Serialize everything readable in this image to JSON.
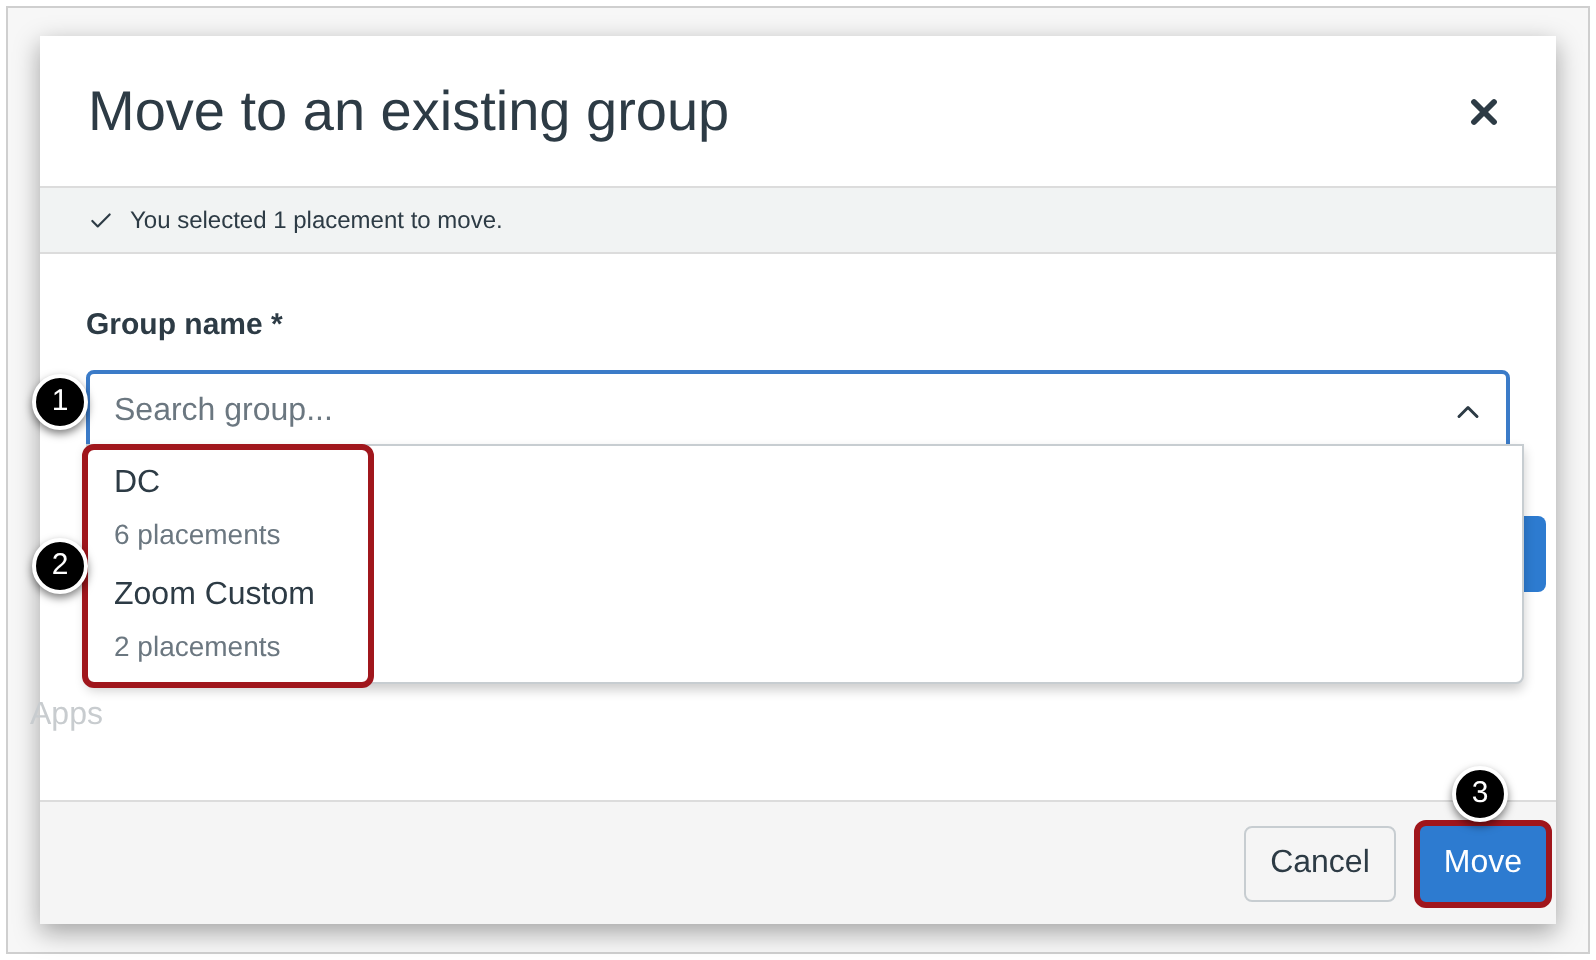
{
  "dialog": {
    "title": "Move to an existing group",
    "notice": "You selected 1 placement to move.",
    "field": {
      "label": "Group name *",
      "placeholder": "Search group...",
      "expanded": true
    },
    "options": [
      {
        "name": "DC",
        "count": "6 placements"
      },
      {
        "name": "Zoom Custom",
        "count": "2 placements"
      }
    ],
    "buttons": [
      {
        "label": "Cancel",
        "kind": "secondary"
      },
      {
        "label": "Move",
        "kind": "primary"
      }
    ]
  },
  "background_text": "Apps",
  "callouts": [
    "1",
    "2",
    "3"
  ]
}
